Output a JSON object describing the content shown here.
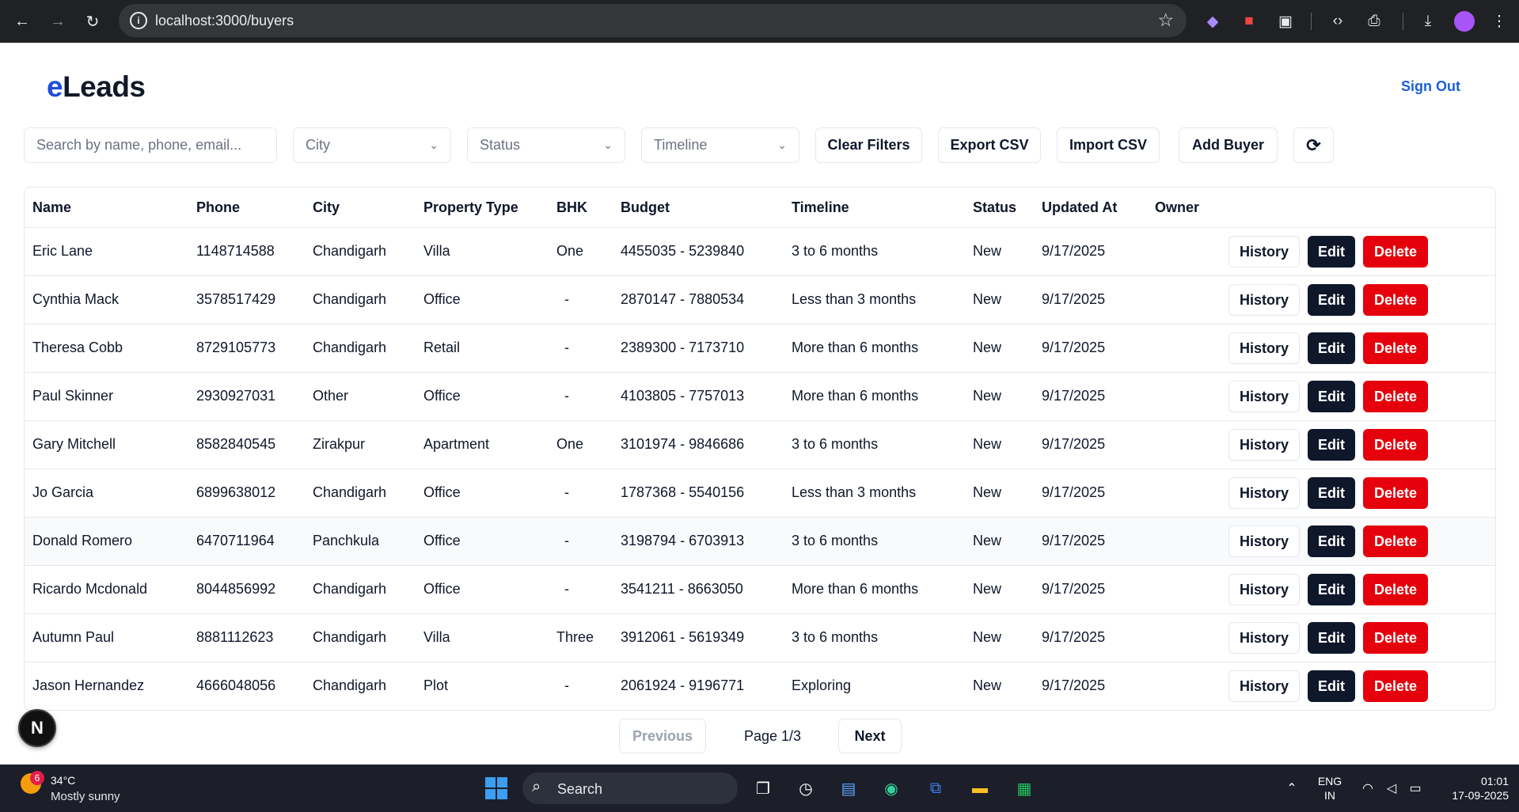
{
  "browser": {
    "url": "localhost:3000/buyers"
  },
  "app": {
    "brand_prefix": "e",
    "brand_rest": "Leads",
    "sign_out": "Sign Out"
  },
  "filters": {
    "search_placeholder": "Search by name, phone, email...",
    "city_placeholder": "City",
    "status_placeholder": "Status",
    "timeline_placeholder": "Timeline",
    "clear_filters": "Clear Filters",
    "export_csv": "Export CSV",
    "import_csv": "Import CSV",
    "add_buyer": "Add Buyer"
  },
  "table": {
    "headers": [
      "Name",
      "Phone",
      "City",
      "Property Type",
      "BHK",
      "Budget",
      "Timeline",
      "Status",
      "Updated At",
      "Owner"
    ],
    "action_labels": {
      "history": "History",
      "edit": "Edit",
      "delete": "Delete"
    },
    "rows": [
      {
        "name": "Eric Lane",
        "phone": "1148714588",
        "city": "Chandigarh",
        "property_type": "Villa",
        "bhk": "One",
        "budget": "4455035 - 5239840",
        "timeline": "3 to 6 months",
        "status": "New",
        "updated_at": "9/17/2025",
        "owner": ""
      },
      {
        "name": "Cynthia Mack",
        "phone": "3578517429",
        "city": "Chandigarh",
        "property_type": "Office",
        "bhk": "-",
        "budget": "2870147 - 7880534",
        "timeline": "Less than 3 months",
        "status": "New",
        "updated_at": "9/17/2025",
        "owner": ""
      },
      {
        "name": "Theresa Cobb",
        "phone": "8729105773",
        "city": "Chandigarh",
        "property_type": "Retail",
        "bhk": "-",
        "budget": "2389300 - 7173710",
        "timeline": "More than 6 months",
        "status": "New",
        "updated_at": "9/17/2025",
        "owner": ""
      },
      {
        "name": "Paul Skinner",
        "phone": "2930927031",
        "city": "Other",
        "property_type": "Office",
        "bhk": "-",
        "budget": "4103805 - 7757013",
        "timeline": "More than 6 months",
        "status": "New",
        "updated_at": "9/17/2025",
        "owner": ""
      },
      {
        "name": "Gary Mitchell",
        "phone": "8582840545",
        "city": "Zirakpur",
        "property_type": "Apartment",
        "bhk": "One",
        "budget": "3101974 - 9846686",
        "timeline": "3 to 6 months",
        "status": "New",
        "updated_at": "9/17/2025",
        "owner": ""
      },
      {
        "name": "Jo Garcia",
        "phone": "6899638012",
        "city": "Chandigarh",
        "property_type": "Office",
        "bhk": "-",
        "budget": "1787368 - 5540156",
        "timeline": "Less than 3 months",
        "status": "New",
        "updated_at": "9/17/2025",
        "owner": ""
      },
      {
        "name": "Donald Romero",
        "phone": "6470711964",
        "city": "Panchkula",
        "property_type": "Office",
        "bhk": "-",
        "budget": "3198794 - 6703913",
        "timeline": "3 to 6 months",
        "status": "New",
        "updated_at": "9/17/2025",
        "owner": ""
      },
      {
        "name": "Ricardo Mcdonald",
        "phone": "8044856992",
        "city": "Chandigarh",
        "property_type": "Office",
        "bhk": "-",
        "budget": "3541211 - 8663050",
        "timeline": "More than 6 months",
        "status": "New",
        "updated_at": "9/17/2025",
        "owner": ""
      },
      {
        "name": "Autumn Paul",
        "phone": "8881112623",
        "city": "Chandigarh",
        "property_type": "Villa",
        "bhk": "Three",
        "budget": "3912061 - 5619349",
        "timeline": "3 to 6 months",
        "status": "New",
        "updated_at": "9/17/2025",
        "owner": ""
      },
      {
        "name": "Jason Hernandez",
        "phone": "4666048056",
        "city": "Chandigarh",
        "property_type": "Plot",
        "bhk": "-",
        "budget": "2061924 - 9196771",
        "timeline": "Exploring",
        "status": "New",
        "updated_at": "9/17/2025",
        "owner": ""
      }
    ]
  },
  "pagination": {
    "previous": "Previous",
    "page_text": "Page 1/3",
    "next": "Next"
  },
  "dev_badge": "N",
  "taskbar": {
    "weather_badge": "6",
    "temperature": "34°C",
    "condition": "Mostly sunny",
    "search_label": "Search",
    "lang_top": "ENG",
    "lang_bottom": "IN",
    "time": "01:01",
    "date": "17-09-2025"
  },
  "colors": {
    "brand_blue": "#1d4ed8",
    "edit_bg": "#0f172a",
    "delete_bg": "#e5000b",
    "link_blue": "#1d5fd6"
  }
}
